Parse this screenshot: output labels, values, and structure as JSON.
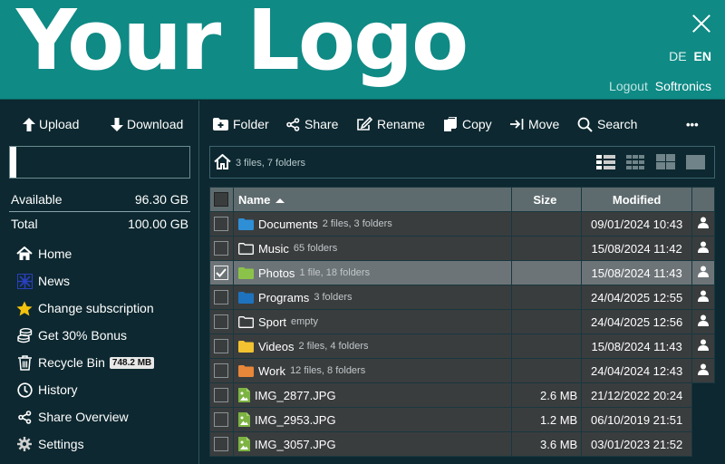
{
  "header": {
    "logo": "Your Logo",
    "languages": [
      {
        "label": "DE",
        "active": false
      },
      {
        "label": "EN",
        "active": true
      }
    ],
    "logout_label": "Logout",
    "username": "Softronics"
  },
  "sidebar": {
    "upload_label": "Upload",
    "download_label": "Download",
    "quota_fraction": 0.037,
    "available_label": "Available",
    "available_value": "96.30 GB",
    "total_label": "Total",
    "total_value": "100.00 GB",
    "nav": [
      {
        "label": "Home",
        "icon": "home-icon"
      },
      {
        "label": "News",
        "icon": "news-icon"
      },
      {
        "label": "Change subscription",
        "icon": "star-icon"
      },
      {
        "label": "Get 30% Bonus",
        "icon": "coins-icon"
      },
      {
        "label": "Recycle Bin",
        "icon": "trash-icon",
        "badge": "748.2 MB"
      },
      {
        "label": "History",
        "icon": "clock-icon"
      },
      {
        "label": "Share Overview",
        "icon": "share-icon"
      },
      {
        "label": "Settings",
        "icon": "gear-icon"
      }
    ]
  },
  "toolbar": {
    "folder_label": "Folder",
    "share_label": "Share",
    "rename_label": "Rename",
    "copy_label": "Copy",
    "move_label": "Move",
    "search_label": "Search",
    "more_label": "•••"
  },
  "pathbar": {
    "summary": "3 files, 7 folders"
  },
  "table": {
    "col_name": "Name",
    "col_size": "Size",
    "col_modified": "Modified",
    "rows": [
      {
        "name": "Documents",
        "meta": "2 files, 3 folders",
        "size": "",
        "modified": "09/01/2024 10:43",
        "kind": "folder",
        "color": "#2f8fd6",
        "checked": false,
        "shared": true
      },
      {
        "name": "Music",
        "meta": "65 folders",
        "size": "",
        "modified": "15/08/2024 11:42",
        "kind": "folder-outline",
        "color": "#ffffff",
        "checked": false,
        "shared": true
      },
      {
        "name": "Photos",
        "meta": "1 file, 18 folders",
        "size": "",
        "modified": "15/08/2024 11:43",
        "kind": "folder",
        "color": "#8bc34a",
        "checked": true,
        "shared": true
      },
      {
        "name": "Programs",
        "meta": "3 folders",
        "size": "",
        "modified": "24/04/2025 12:55",
        "kind": "folder",
        "color": "#1e73be",
        "checked": false,
        "shared": true
      },
      {
        "name": "Sport",
        "meta": "empty",
        "size": "",
        "modified": "24/04/2025 12:56",
        "kind": "folder-outline",
        "color": "#ffffff",
        "checked": false,
        "shared": true
      },
      {
        "name": "Videos",
        "meta": "2 files, 4 folders",
        "size": "",
        "modified": "15/08/2024 11:43",
        "kind": "folder",
        "color": "#f2c230",
        "checked": false,
        "shared": true
      },
      {
        "name": "Work",
        "meta": "12 files, 8 folders",
        "size": "",
        "modified": "24/04/2024 12:43",
        "kind": "folder",
        "color": "#e8873a",
        "checked": false,
        "shared": true
      },
      {
        "name": "IMG_2877.JPG",
        "meta": "",
        "size": "2.6 MB",
        "modified": "21/12/2022 20:24",
        "kind": "image",
        "color": "#7cb342",
        "checked": false,
        "shared": false
      },
      {
        "name": "IMG_2953.JPG",
        "meta": "",
        "size": "1.2 MB",
        "modified": "06/10/2019 21:51",
        "kind": "image",
        "color": "#7cb342",
        "checked": false,
        "shared": false
      },
      {
        "name": "IMG_3057.JPG",
        "meta": "",
        "size": "3.6 MB",
        "modified": "03/01/2023 21:52",
        "kind": "image",
        "color": "#7cb342",
        "checked": false,
        "shared": false
      }
    ]
  }
}
